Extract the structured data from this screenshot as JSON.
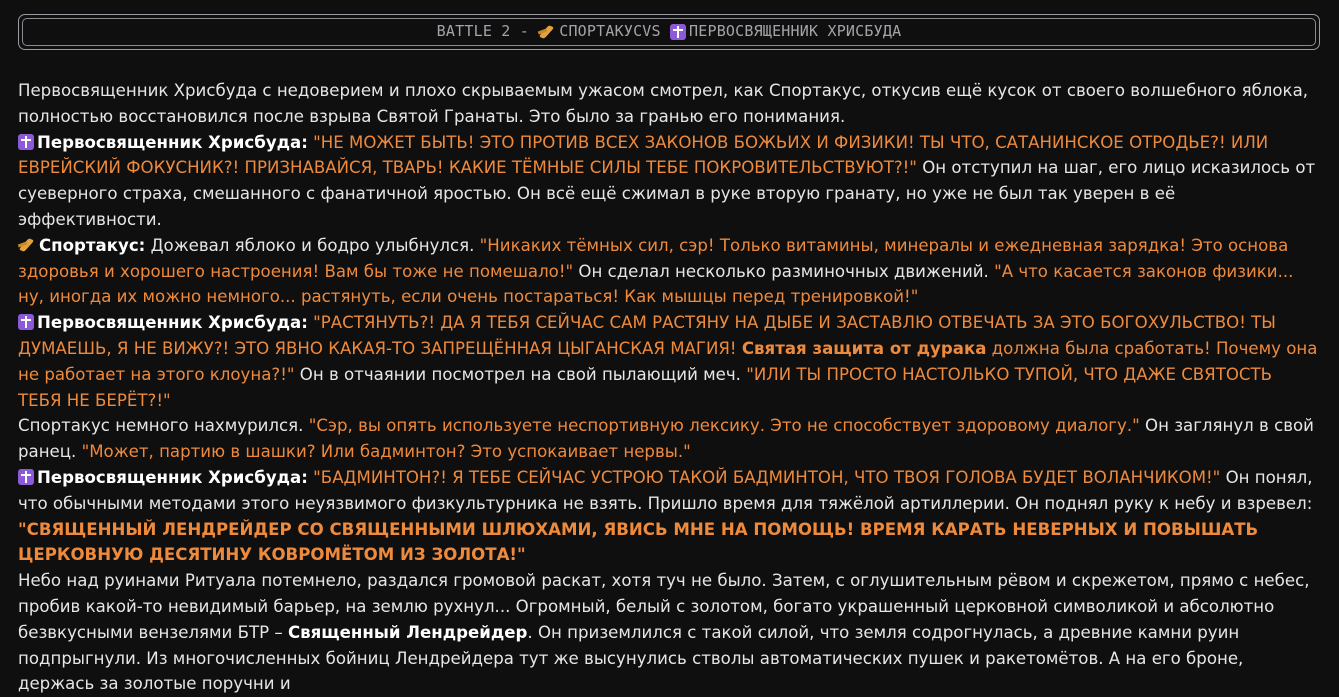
{
  "header": {
    "prefix": "BATTLE 2 - ",
    "fighter1": "СПОРТАКУС",
    "vs": " VS ",
    "fighter2": "ПЕРВОСВЯЩЕННИК ХРИСБУДА",
    "fighter1_icon": "runner-icon",
    "fighter2_icon": "latin-cross-icon"
  },
  "story": {
    "p1": "Первосвященник Хрисбуда с недоверием и плохо скрываемым ужасом смотрел, как Спортакус, откусив ещё кусок от своего волшебного яблока, полностью восстановился после взрыва Святой Гранаты. Это было за гранью его понимания.",
    "p2_name": "Первосвященник Хрисбуда:",
    "p2_quote": "\"НЕ МОЖЕТ БЫТЬ! ЭТО ПРОТИВ ВСЕХ ЗАКОНОВ БОЖЬИХ И ФИЗИКИ! ТЫ ЧТО, САТАНИНСКОЕ ОТРОДЬЕ?! ИЛИ ЕВРЕЙСКИЙ ФОКУСНИК?! ПРИЗНАВАЙСЯ, ТВАРЬ! КАКИЕ ТЁМНЫЕ СИЛЫ ТЕБЕ ПОКРОВИТЕЛЬСТВУЮТ?!\"",
    "p2_text": " Он отступил на шаг, его лицо исказилось от суеверного страха, смешанного с фанатичной яростью. Он всё ещё сжимал в руке вторую гранату, но уже не был так уверен в её эффективности.",
    "p3_name": "Спортакус:",
    "p3_text1": " Дожевал яблоко и бодро улыбнулся. ",
    "p3_quote1": "\"Никаких тёмных сил, сэр! Только витамины, минералы и ежедневная зарядка! Это основа здоровья и хорошего настроения! Вам бы тоже не помешало!\"",
    "p3_text2": " Он сделал несколько разминочных движений. ",
    "p3_quote2": "\"А что касается законов физики... ну, иногда их можно немного... растянуть, если очень постараться! Как мышцы перед тренировкой!\"",
    "p4_name": "Первосвященник Хрисбуда:",
    "p4_quote1": "\"РАСТЯНУТЬ?! ДА Я ТЕБЯ СЕЙЧАС САМ РАСТЯНУ НА ДЫБЕ И ЗАСТАВЛЮ ОТВЕЧАТЬ ЗА ЭТО БОГОХУЛЬСТВО! ТЫ ДУМАЕШЬ, Я НЕ ВИЖУ?! ЭТО ЯВНО КАКАЯ-ТО ЗАПРЕЩЁННАЯ ЦЫГАНСКАЯ МАГИЯ! ",
    "p4_quote_bold": "Святая защита от дурака",
    "p4_quote2": " должна была сработать! Почему она не работает на этого клоуна?!\"",
    "p4_text": " Он в отчаянии посмотрел на свой пылающий меч. ",
    "p4_quote3": "\"ИЛИ ТЫ ПРОСТО НАСТОЛЬКО ТУПОЙ, ЧТО ДАЖЕ СВЯТОСТЬ ТЕБЯ НЕ БЕРЁТ?!\"",
    "p5_text1": "Спортакус немного нахмурился. ",
    "p5_quote1": "\"Сэр, вы опять используете неспортивную лексику. Это не способствует здоровому диалогу.\"",
    "p5_text2": " Он заглянул в свой ранец. ",
    "p5_quote2": "\"Может, партию в шашки? Или бадминтон? Это успокаивает нервы.\"",
    "p6_name": "Первосвященник Хрисбуда:",
    "p6_quote": "\"БАДМИНТОН?! Я ТЕБЕ СЕЙЧАС УСТРОЮ ТАКОЙ БАДМИНТОН, ЧТО ТВОЯ ГОЛОВА БУДЕТ ВОЛАНЧИКОМ!\"",
    "p6_text": " Он понял, что обычными методами этого неуязвимого физкультурника не взять. Пришло время для тяжёлой артиллерии. Он поднял руку к небу и взревел:",
    "p7_quote": "\"СВЯЩЕННЫЙ ЛЕНДРЕЙДЕР СО СВЯЩЕННЫМИ ШЛЮХАМИ, ЯВИСЬ МНЕ НА ПОМОЩЬ! ВРЕМЯ КАРАТЬ НЕВЕРНЫХ И ПОВЫШАТЬ ЦЕРКОВНУЮ ДЕСЯТИНУ КОВРОМЁТОМ ИЗ ЗОЛОТА!\"",
    "p8_text1": "Небо над руинами Ритуала потемнело, раздался громовой раскат, хотя туч не было. Затем, с оглушительным рёвом и скрежетом, прямо с небес, пробив какой-то невидимый барьер, на землю рухнул... Огромный, белый с золотом, богато украшенный церковной символикой и абсолютно безвкусными вензелями БТР – ",
    "p8_bold": "Священный Лендрейдер",
    "p8_text2": ". Он приземлился с такой силой, что земля содрогнулась, а древние камни руин подпрыгнули. Из многочисленных бойниц Лендрейдера тут же высунулись стволы автоматических пушек и ракетомётов. А на его броне, держась за золотые поручни и"
  }
}
